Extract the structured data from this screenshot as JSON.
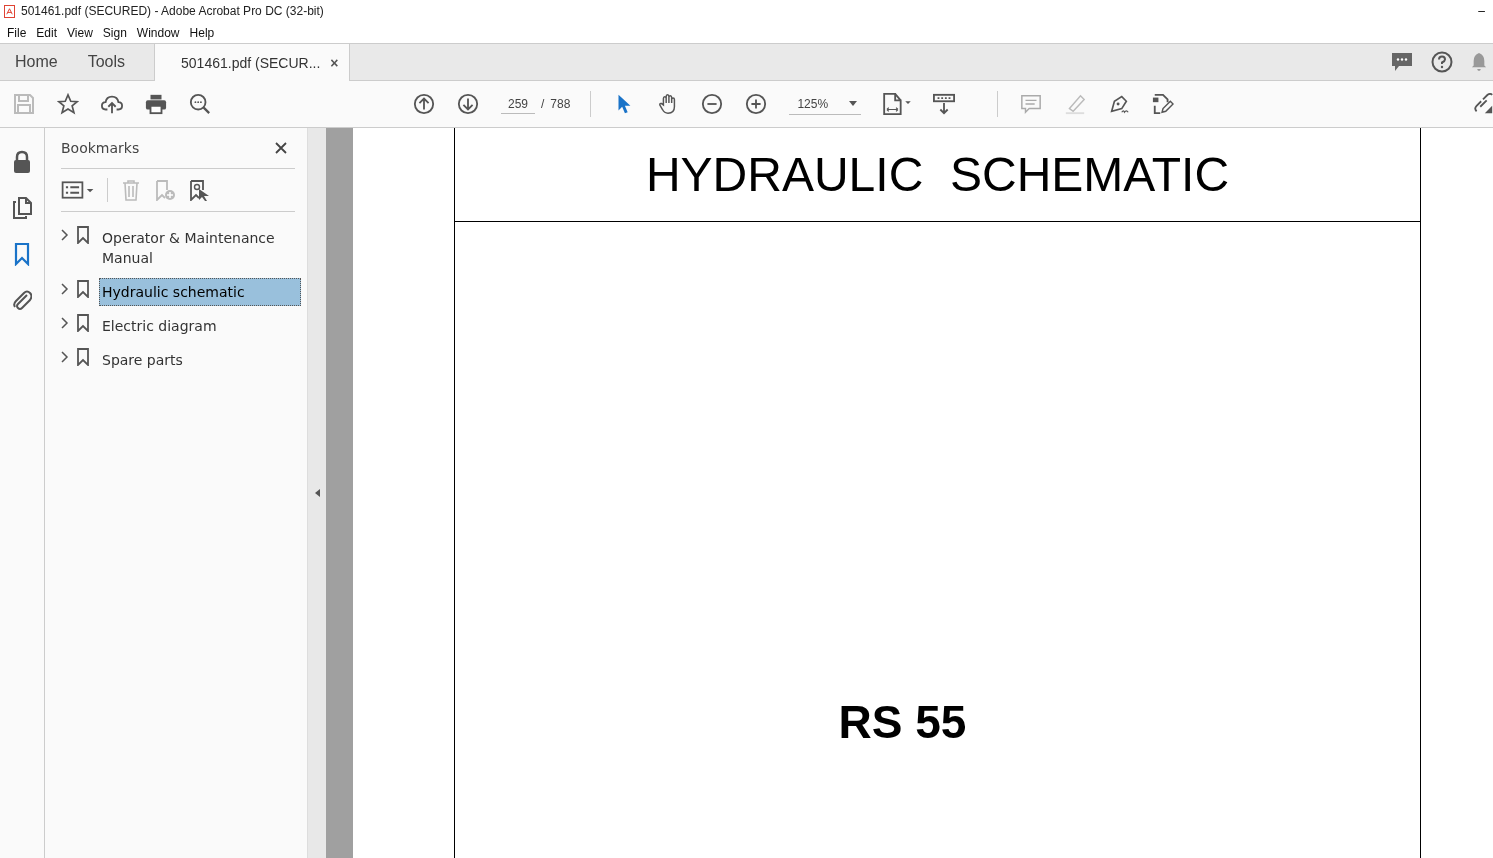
{
  "window": {
    "title": "501461.pdf (SECURED) - Adobe Acrobat Pro DC (32-bit)",
    "minimize": "–"
  },
  "menu": [
    "File",
    "Edit",
    "View",
    "Sign",
    "Window",
    "Help"
  ],
  "tabs": [
    {
      "label": "Home",
      "selected": false,
      "kind": "nav"
    },
    {
      "label": "Tools",
      "selected": false,
      "kind": "nav"
    },
    {
      "label": "501461.pdf (SECUR...",
      "selected": true,
      "kind": "document",
      "close": "×"
    }
  ],
  "toolbar": {
    "page": "259",
    "page_separator": "/",
    "page_total": "788",
    "zoom": "125%"
  },
  "side_rail": [
    {
      "kind": "lock",
      "selected": false
    },
    {
      "kind": "pages",
      "selected": false
    },
    {
      "kind": "bookmark",
      "selected": true
    },
    {
      "kind": "attachment",
      "selected": false
    }
  ],
  "bookmarks": {
    "title": "Bookmarks",
    "items": [
      {
        "label": "Operator & Maintenance Manual",
        "selected": false,
        "expanded": false
      },
      {
        "label": "Hydraulic schematic",
        "selected": true,
        "expanded": false
      },
      {
        "label": "Electric diagram",
        "selected": false,
        "expanded": false
      },
      {
        "label": "Spare parts",
        "selected": false,
        "expanded": false
      }
    ]
  },
  "document": {
    "heading": "HYDRAULIC  SCHEMATIC",
    "model": "RS 55"
  }
}
